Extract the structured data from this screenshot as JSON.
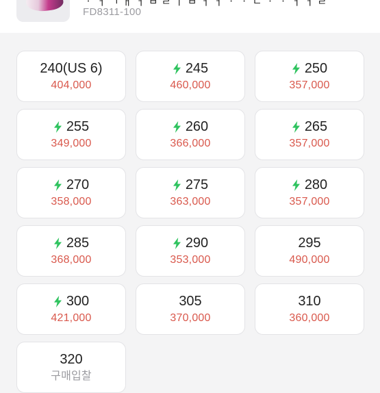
{
  "product": {
    "title_partial": "ㆍ ㅓ ㄱ ㅐ ㅓ ㅂ ㄹ ㅣ ㅂ ㅓ ㅓ ㆍ ㆍ ㄴ ㆍ ㆍ ㅓ ㅓ ㄹ",
    "model_code": "FD8311-100",
    "thumbnail_icon": "shoe-thumbnail"
  },
  "colors": {
    "price": "#d9584c",
    "bolt": "#2fc35f",
    "status": "#9b9ba0"
  },
  "sizes": [
    {
      "label": "240(US 6)",
      "price": "404,000",
      "fast": false
    },
    {
      "label": "245",
      "price": "460,000",
      "fast": true
    },
    {
      "label": "250",
      "price": "357,000",
      "fast": true
    },
    {
      "label": "255",
      "price": "349,000",
      "fast": true
    },
    {
      "label": "260",
      "price": "366,000",
      "fast": true
    },
    {
      "label": "265",
      "price": "357,000",
      "fast": true
    },
    {
      "label": "270",
      "price": "358,000",
      "fast": true
    },
    {
      "label": "275",
      "price": "363,000",
      "fast": true
    },
    {
      "label": "280",
      "price": "357,000",
      "fast": true
    },
    {
      "label": "285",
      "price": "368,000",
      "fast": true
    },
    {
      "label": "290",
      "price": "353,000",
      "fast": true
    },
    {
      "label": "295",
      "price": "490,000",
      "fast": false
    },
    {
      "label": "300",
      "price": "421,000",
      "fast": true
    },
    {
      "label": "305",
      "price": "370,000",
      "fast": false
    },
    {
      "label": "310",
      "price": "360,000",
      "fast": false
    },
    {
      "label": "320",
      "price": "구매입찰",
      "fast": false,
      "status": true
    }
  ]
}
